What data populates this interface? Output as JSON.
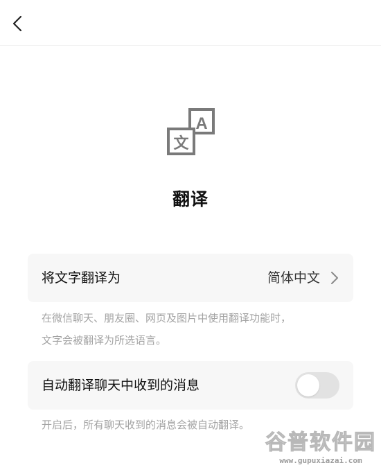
{
  "nav": {
    "back_icon": "chevron-left-icon"
  },
  "hero": {
    "icon": "translate-icon",
    "icon_glyph_a": "A",
    "icon_glyph_wen": "文",
    "title": "翻译"
  },
  "translate_setting": {
    "label": "将文字翻译为",
    "value": "简体中文",
    "chevron_icon": "chevron-right-icon",
    "note_line1": "在微信聊天、朋友圈、网页及图片中使用翻译功能时，",
    "note_line2": "文字会被翻译为所选语言。"
  },
  "auto_translate": {
    "label": "自动翻译聊天中收到的消息",
    "enabled": false,
    "note": "开启后，所有聊天收到的消息会被自动翻译。"
  },
  "watermark": {
    "title": "谷普软件园",
    "url": "www.gupuxiazai.com"
  },
  "colors": {
    "card_bg": "#f7f7f7",
    "note_text": "#a3a3a3",
    "toggle_off": "#e2e2e2",
    "icon_gray": "#7a7a7a"
  }
}
